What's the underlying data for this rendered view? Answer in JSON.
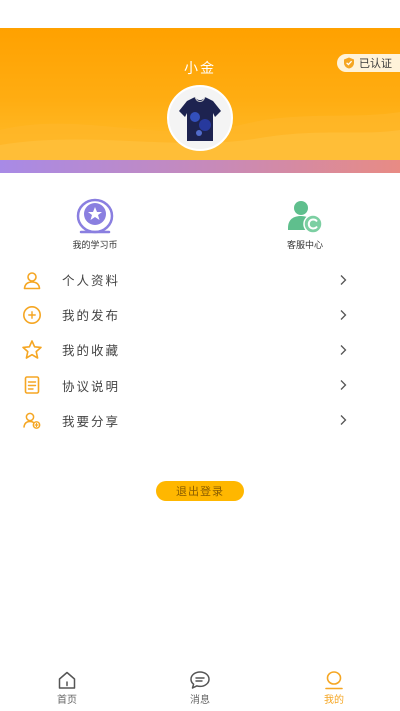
{
  "header": {
    "user_name": "小金",
    "verified_label": "已认证"
  },
  "quick_actions": [
    {
      "label": "我的学习币",
      "icon": "coin-star-icon",
      "color": "#8a7fe0"
    },
    {
      "label": "客服中心",
      "icon": "customer-service-icon",
      "color": "#5fbf8d"
    }
  ],
  "menu": {
    "items": [
      {
        "label": "个人资料",
        "icon": "user-icon"
      },
      {
        "label": "我的发布",
        "icon": "plus-circle-icon"
      },
      {
        "label": "我的收藏",
        "icon": "star-icon"
      },
      {
        "label": "协议说明",
        "icon": "document-icon"
      },
      {
        "label": "我要分享",
        "icon": "share-users-icon"
      }
    ]
  },
  "logout_label": "退出登录",
  "tabbar": {
    "tabs": [
      {
        "label": "首页",
        "icon": "home-icon",
        "active": false
      },
      {
        "label": "消息",
        "icon": "message-icon",
        "active": false
      },
      {
        "label": "我的",
        "icon": "profile-icon",
        "active": true
      }
    ]
  },
  "colors": {
    "header": "#ffa100",
    "accent_gradient_start": "#a88ae6",
    "accent_gradient_end": "#e88b84",
    "primary": "#f5a623",
    "logout_button": "#ffb700"
  }
}
